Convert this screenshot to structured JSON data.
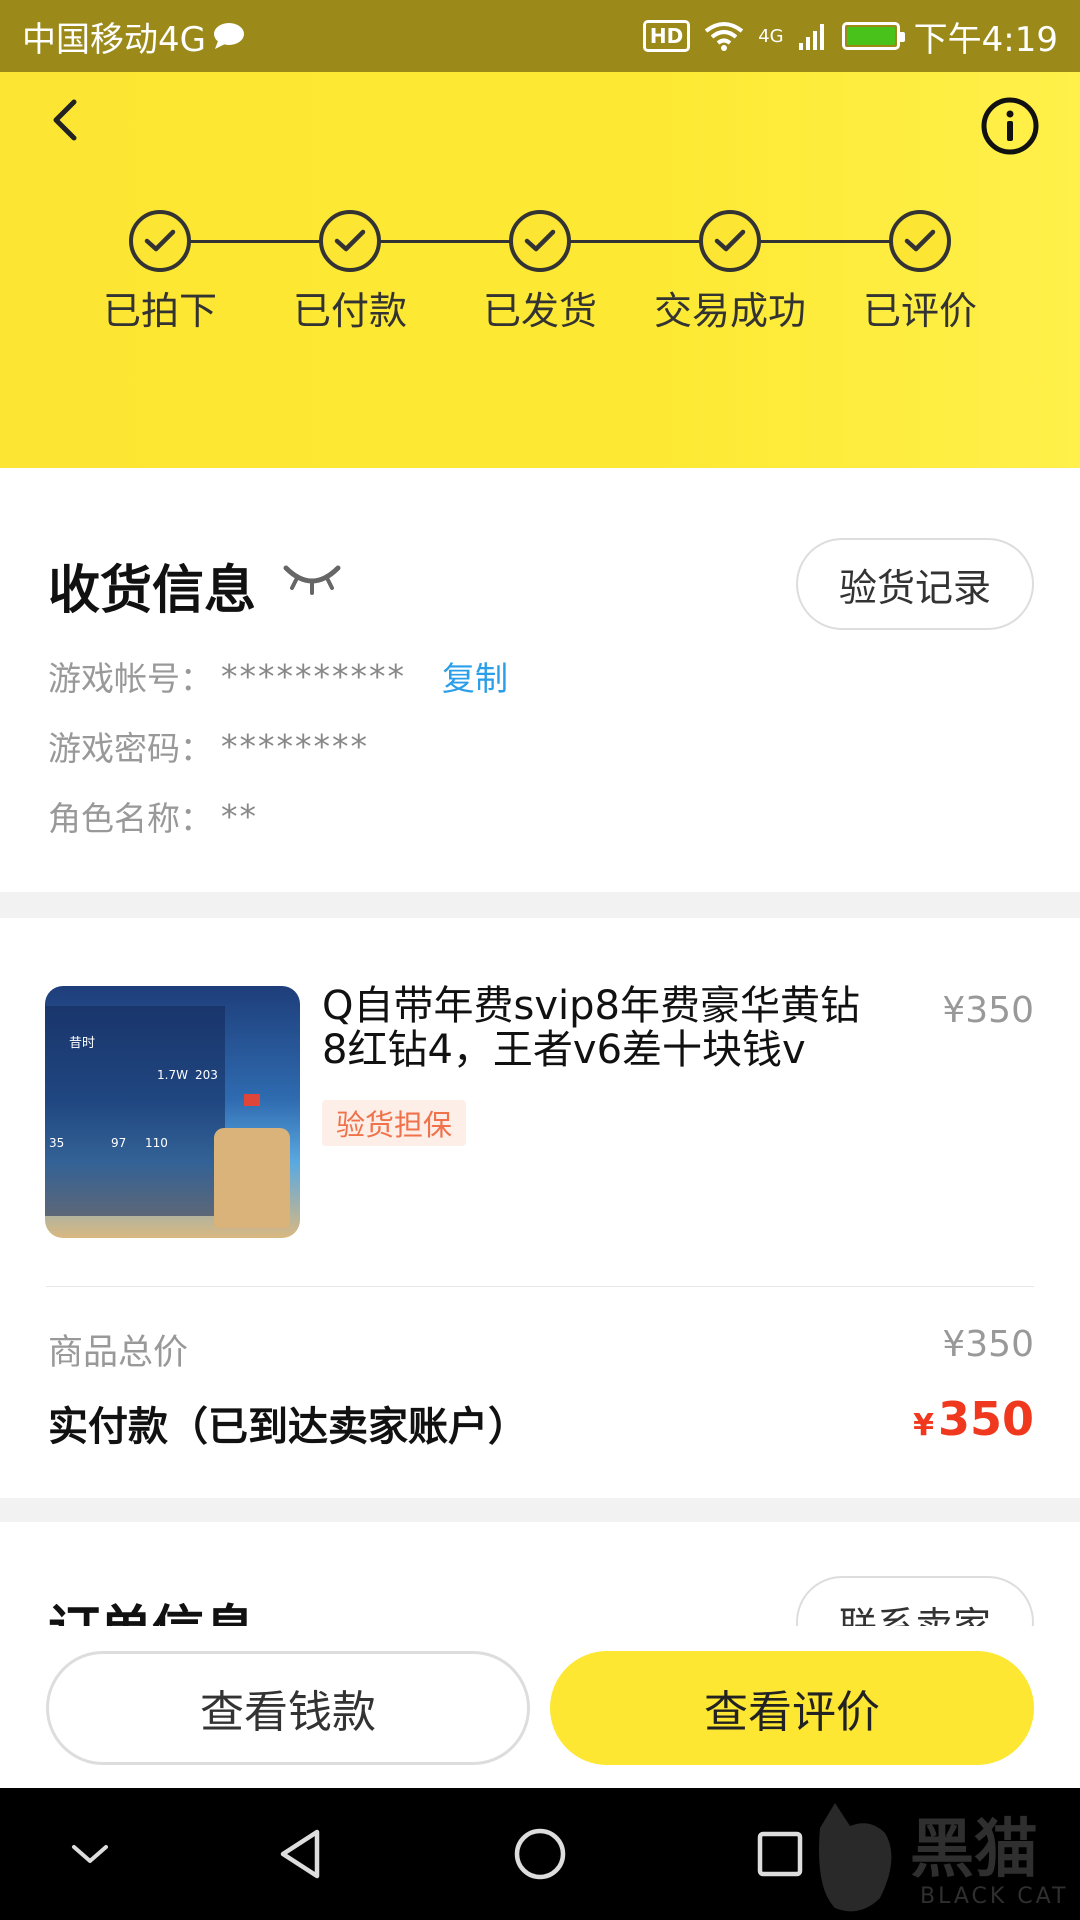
{
  "status_bar": {
    "carrier": "中国移动4G",
    "time": "下午4:19",
    "hd": "HD",
    "network": "4G"
  },
  "steps": [
    {
      "label": "已拍下"
    },
    {
      "label": "已付款"
    },
    {
      "label": "已发货"
    },
    {
      "label": "交易成功"
    },
    {
      "label": "已评价"
    }
  ],
  "delivery": {
    "title": "收货信息",
    "inspect_button": "验货记录",
    "account_label": "游戏帐号：",
    "account_value": "**********",
    "copy_label": "复制",
    "password_label": "游戏密码：",
    "password_value": "********",
    "role_label": "角色名称：",
    "role_value": "**"
  },
  "product": {
    "title": "Q自带年费svip8年费豪华黄钻8红钻4，王者v6差十块钱v",
    "price": "¥350",
    "tag": "验货担保",
    "total_label": "商品总价",
    "total_value": "¥350",
    "paid_label": "实付款（已到达卖家账户）",
    "paid_currency": "¥",
    "paid_value": "350",
    "thumb_texts": {
      "name": "昔时",
      "stat1": "1.7W",
      "stat2": "203",
      "stat3": "35",
      "stat4": "97",
      "stat5": "110"
    }
  },
  "order": {
    "title": "订单信息",
    "contact_button": "联系卖家"
  },
  "actions": {
    "view_money": "查看钱款",
    "view_review": "查看评价"
  },
  "watermark": {
    "text": "黑猫",
    "sub": "BLACK CAT"
  },
  "colors": {
    "header_yellow": "#fde633",
    "status_bar": "#9b8a1a",
    "price_red": "#f0381e",
    "link_blue": "#2a9ee8",
    "tag_orange": "#f0724b"
  }
}
